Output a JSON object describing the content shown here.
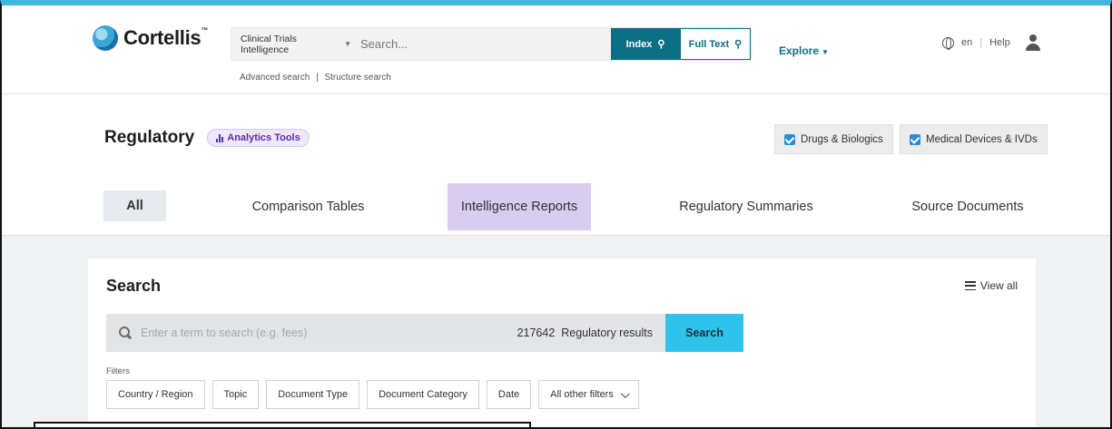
{
  "header": {
    "logo_text": "Cortellis",
    "logo_tm": "™",
    "scope_selector": "Clinical Trials Intelligence",
    "search_placeholder": "Search...",
    "index_button": "Index",
    "fulltext_button": "Full Text",
    "advanced_search": "Advanced search",
    "link_separator": "|",
    "structure_search": "Structure search",
    "explore": "Explore",
    "language": "en",
    "help": "Help"
  },
  "page": {
    "title": "Regulatory",
    "analytics_tools": "Analytics Tools",
    "toggles": [
      {
        "label": "Drugs & Biologics",
        "checked": true
      },
      {
        "label": "Medical Devices & IVDs",
        "checked": true
      }
    ],
    "tabs": [
      {
        "label": "All",
        "state": "selected"
      },
      {
        "label": "Comparison Tables"
      },
      {
        "label": "Intelligence Reports",
        "state": "highlighted"
      },
      {
        "label": "Regulatory Summaries"
      },
      {
        "label": "Source Documents"
      }
    ]
  },
  "search_card": {
    "title": "Search",
    "view_all": "View all",
    "input_placeholder": "Enter a term to search (e.g. fees)",
    "result_count": "217642",
    "result_label": "Regulatory results",
    "search_button": "Search",
    "filters_label": "Filters",
    "filters": [
      "Country / Region",
      "Topic",
      "Document Type",
      "Document Category",
      "Date",
      "All other filters"
    ]
  },
  "colors": {
    "accent_bar": "#3fb6e0",
    "index_button": "#0c6f83",
    "search_button": "#2ec3ea",
    "tab_highlight": "#d8ccef",
    "analytics_pill": "#efe7fb"
  }
}
